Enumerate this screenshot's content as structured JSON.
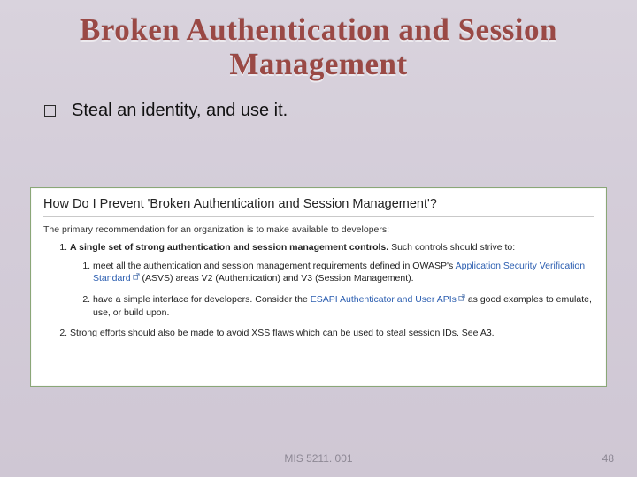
{
  "title_line1": "Broken Authentication and Session",
  "title_line2": "Management",
  "bullet_text": "Steal an identity, and use it.",
  "panel": {
    "heading": "How Do I Prevent 'Broken Authentication and Session Management'?",
    "intro": "The primary recommendation for an organization is to make available to developers:",
    "item1_bold": "A single set of strong authentication and session management controls.",
    "item1_tail": " Such controls should strive to:",
    "sub1_pre": "meet all the authentication and session management requirements defined in OWASP's ",
    "sub1_link": "Application Security Verification Standard",
    "sub1_post": " (ASVS) areas V2 (Authentication) and V3 (Session Management).",
    "sub2_pre": "have a simple interface for developers. Consider the ",
    "sub2_link": "ESAPI Authenticator and User APIs",
    "sub2_post": " as good examples to emulate, use, or build upon.",
    "item2": "Strong efforts should also be made to avoid XSS flaws which can be used to steal session IDs. See A3."
  },
  "footer": {
    "course": "MIS 5211. 001",
    "page": "48"
  }
}
